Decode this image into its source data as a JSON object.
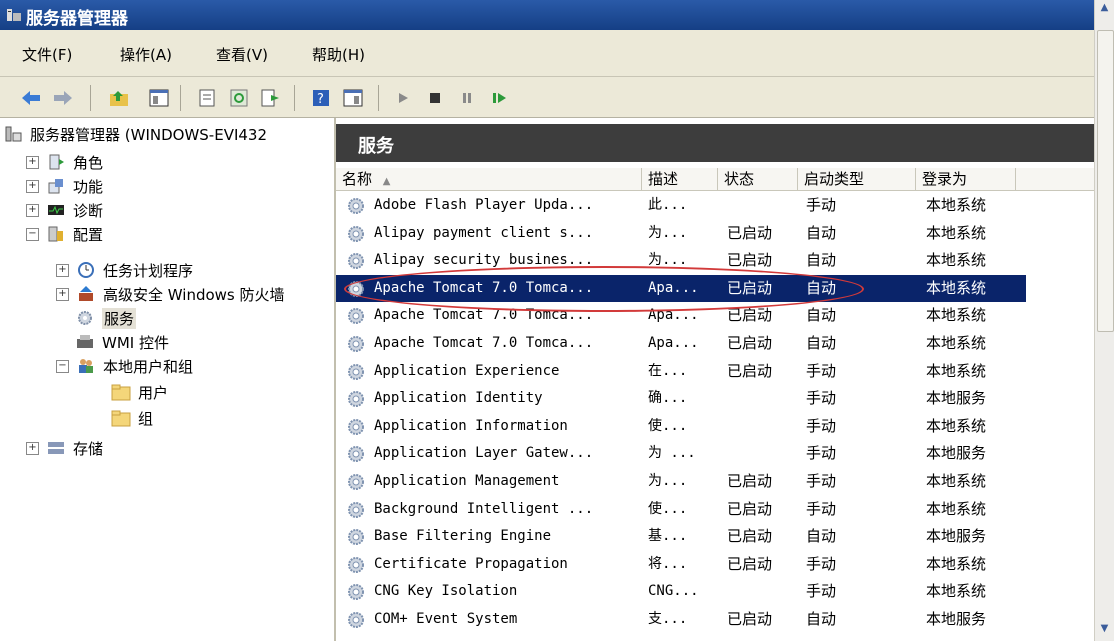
{
  "window": {
    "title": "服务器管理器"
  },
  "menu": [
    "文件(F)",
    "操作(A)",
    "查看(V)",
    "帮助(H)"
  ],
  "tree": {
    "root": "服务器管理器 (WINDOWS-EVI432",
    "roles": "角色",
    "features": "功能",
    "diagnostics": "诊断",
    "configuration": "配置",
    "task_scheduler": "任务计划程序",
    "firewall": "高级安全 Windows 防火墙",
    "services": "服务",
    "wmi": "WMI 控件",
    "local_users": "本地用户和组",
    "users": "用户",
    "groups": "组",
    "storage": "存储"
  },
  "pane": {
    "title": "服务",
    "columns": {
      "name": "名称",
      "desc": "描述",
      "state": "状态",
      "startup": "启动类型",
      "logon": "登录为"
    }
  },
  "services": [
    {
      "name": "Adobe Flash Player Upda...",
      "desc": "此...",
      "state": "",
      "startup": "手动",
      "logon": "本地系统"
    },
    {
      "name": "Alipay payment client s...",
      "desc": "为...",
      "state": "已启动",
      "startup": "自动",
      "logon": "本地系统"
    },
    {
      "name": "Alipay security busines...",
      "desc": "为...",
      "state": "已启动",
      "startup": "自动",
      "logon": "本地系统"
    },
    {
      "name": "Apache Tomcat 7.0 Tomca...",
      "desc": "Apa...",
      "state": "已启动",
      "startup": "自动",
      "logon": "本地系统",
      "selected": true
    },
    {
      "name": "Apache Tomcat 7.0 Tomca...",
      "desc": "Apa...",
      "state": "已启动",
      "startup": "自动",
      "logon": "本地系统"
    },
    {
      "name": "Apache Tomcat 7.0 Tomca...",
      "desc": "Apa...",
      "state": "已启动",
      "startup": "自动",
      "logon": "本地系统"
    },
    {
      "name": "Application Experience",
      "desc": "在...",
      "state": "已启动",
      "startup": "手动",
      "logon": "本地系统"
    },
    {
      "name": "Application Identity",
      "desc": "确...",
      "state": "",
      "startup": "手动",
      "logon": "本地服务"
    },
    {
      "name": "Application Information",
      "desc": "使...",
      "state": "",
      "startup": "手动",
      "logon": "本地系统"
    },
    {
      "name": "Application Layer Gatew...",
      "desc": "为 ...",
      "state": "",
      "startup": "手动",
      "logon": "本地服务"
    },
    {
      "name": "Application Management",
      "desc": "为...",
      "state": "已启动",
      "startup": "手动",
      "logon": "本地系统"
    },
    {
      "name": "Background Intelligent ...",
      "desc": "使...",
      "state": "已启动",
      "startup": "手动",
      "logon": "本地系统"
    },
    {
      "name": "Base Filtering Engine",
      "desc": "基...",
      "state": "已启动",
      "startup": "自动",
      "logon": "本地服务"
    },
    {
      "name": "Certificate Propagation",
      "desc": "将...",
      "state": "已启动",
      "startup": "手动",
      "logon": "本地系统"
    },
    {
      "name": "CNG Key Isolation",
      "desc": "CNG...",
      "state": "",
      "startup": "手动",
      "logon": "本地系统"
    },
    {
      "name": "COM+ Event System",
      "desc": "支...",
      "state": "已启动",
      "startup": "自动",
      "logon": "本地服务"
    }
  ]
}
